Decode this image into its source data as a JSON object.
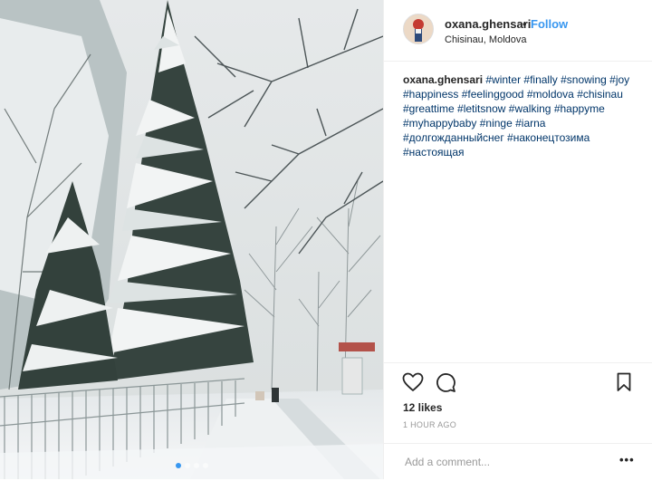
{
  "photo": {
    "description_icon": "winter-photo",
    "carousel_count": 4,
    "carousel_active": 1
  },
  "header": {
    "username": "oxana.ghensari",
    "bullet": "•",
    "follow_label": "Follow",
    "location": "Chisinau, Moldova"
  },
  "caption": {
    "username": "oxana.ghensari",
    "hashtags": [
      "#winter",
      "#finally",
      "#snowing",
      "#joy",
      "#happiness",
      "#feelinggood",
      "#moldova",
      "#chisinau",
      "#greattime",
      "#letitsnow",
      "#walking",
      "#happyme",
      "#myhappybaby",
      "#ninge",
      "#iarna",
      "#долгожданныйснег",
      "#наконецтозима",
      "#настоящая"
    ]
  },
  "actions": {
    "like_icon": "heart-icon",
    "comment_icon": "comment-icon",
    "save_icon": "bookmark-icon",
    "likes": "12 likes",
    "time": "1 HOUR AGO"
  },
  "comment": {
    "placeholder": "Add a comment...",
    "more": "•••"
  },
  "colors": {
    "link": "#003569",
    "follow": "#3897f0",
    "muted": "#999999",
    "text": "#262626"
  }
}
